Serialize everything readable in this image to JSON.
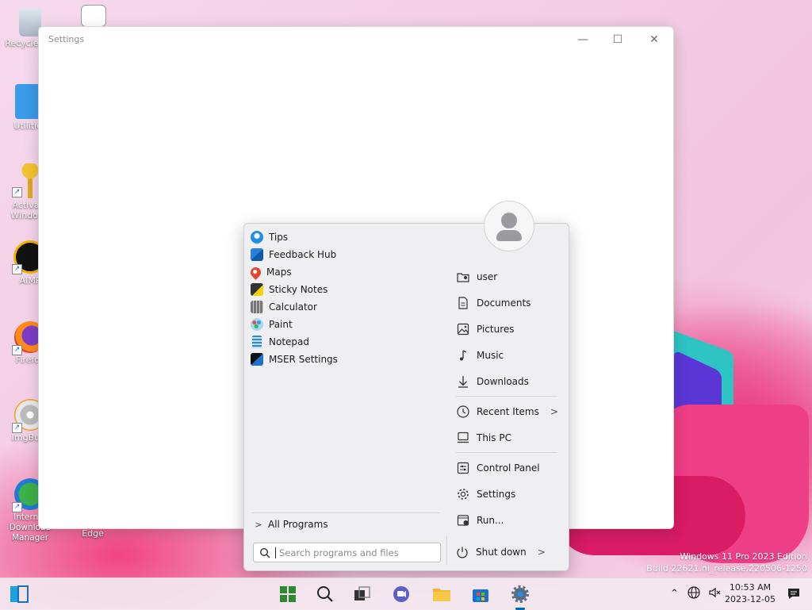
{
  "desktop": {
    "icons": [
      {
        "label": "Recycle Bin"
      },
      {
        "label": "Utilities"
      },
      {
        "label": "Activate Windows"
      },
      {
        "label": "AIMP"
      },
      {
        "label": "Firefox"
      },
      {
        "label": "ImgBurn"
      },
      {
        "label": "Internet Download Manager"
      },
      {
        "label": "Edge"
      }
    ]
  },
  "settings_window": {
    "title": "Settings",
    "minimize": "—",
    "maximize": "☐",
    "close": "✕"
  },
  "start_menu": {
    "programs": [
      {
        "label": "Tips",
        "icon": "tips-icon"
      },
      {
        "label": "Feedback Hub",
        "icon": "feedback-hub-icon"
      },
      {
        "label": "Maps",
        "icon": "maps-icon"
      },
      {
        "label": "Sticky Notes",
        "icon": "sticky-notes-icon"
      },
      {
        "label": "Calculator",
        "icon": "calculator-icon"
      },
      {
        "label": "Paint",
        "icon": "paint-icon"
      },
      {
        "label": "Notepad",
        "icon": "notepad-icon"
      },
      {
        "label": "MSER Settings",
        "icon": "mser-settings-icon"
      }
    ],
    "all_programs": "All Programs",
    "search_placeholder": "Search programs and files",
    "right_items": [
      {
        "label": "user"
      },
      {
        "label": "Documents"
      },
      {
        "label": "Pictures"
      },
      {
        "label": "Music"
      },
      {
        "label": "Downloads"
      },
      {
        "label": "Recent Items"
      },
      {
        "label": "This PC"
      },
      {
        "label": "Control Panel"
      },
      {
        "label": "Settings"
      },
      {
        "label": "Run..."
      }
    ],
    "shutdown": "Shut down"
  },
  "taskbar": {
    "time": "10:53 AM",
    "date": "2023-12-05"
  },
  "watermark": {
    "line1": "Windows 11 Pro 2023 Edition",
    "line2": "Build 22621.ni_release.220506-1250"
  },
  "colors": {
    "accent": "#0067c0",
    "start_bg": "#efeff1"
  }
}
